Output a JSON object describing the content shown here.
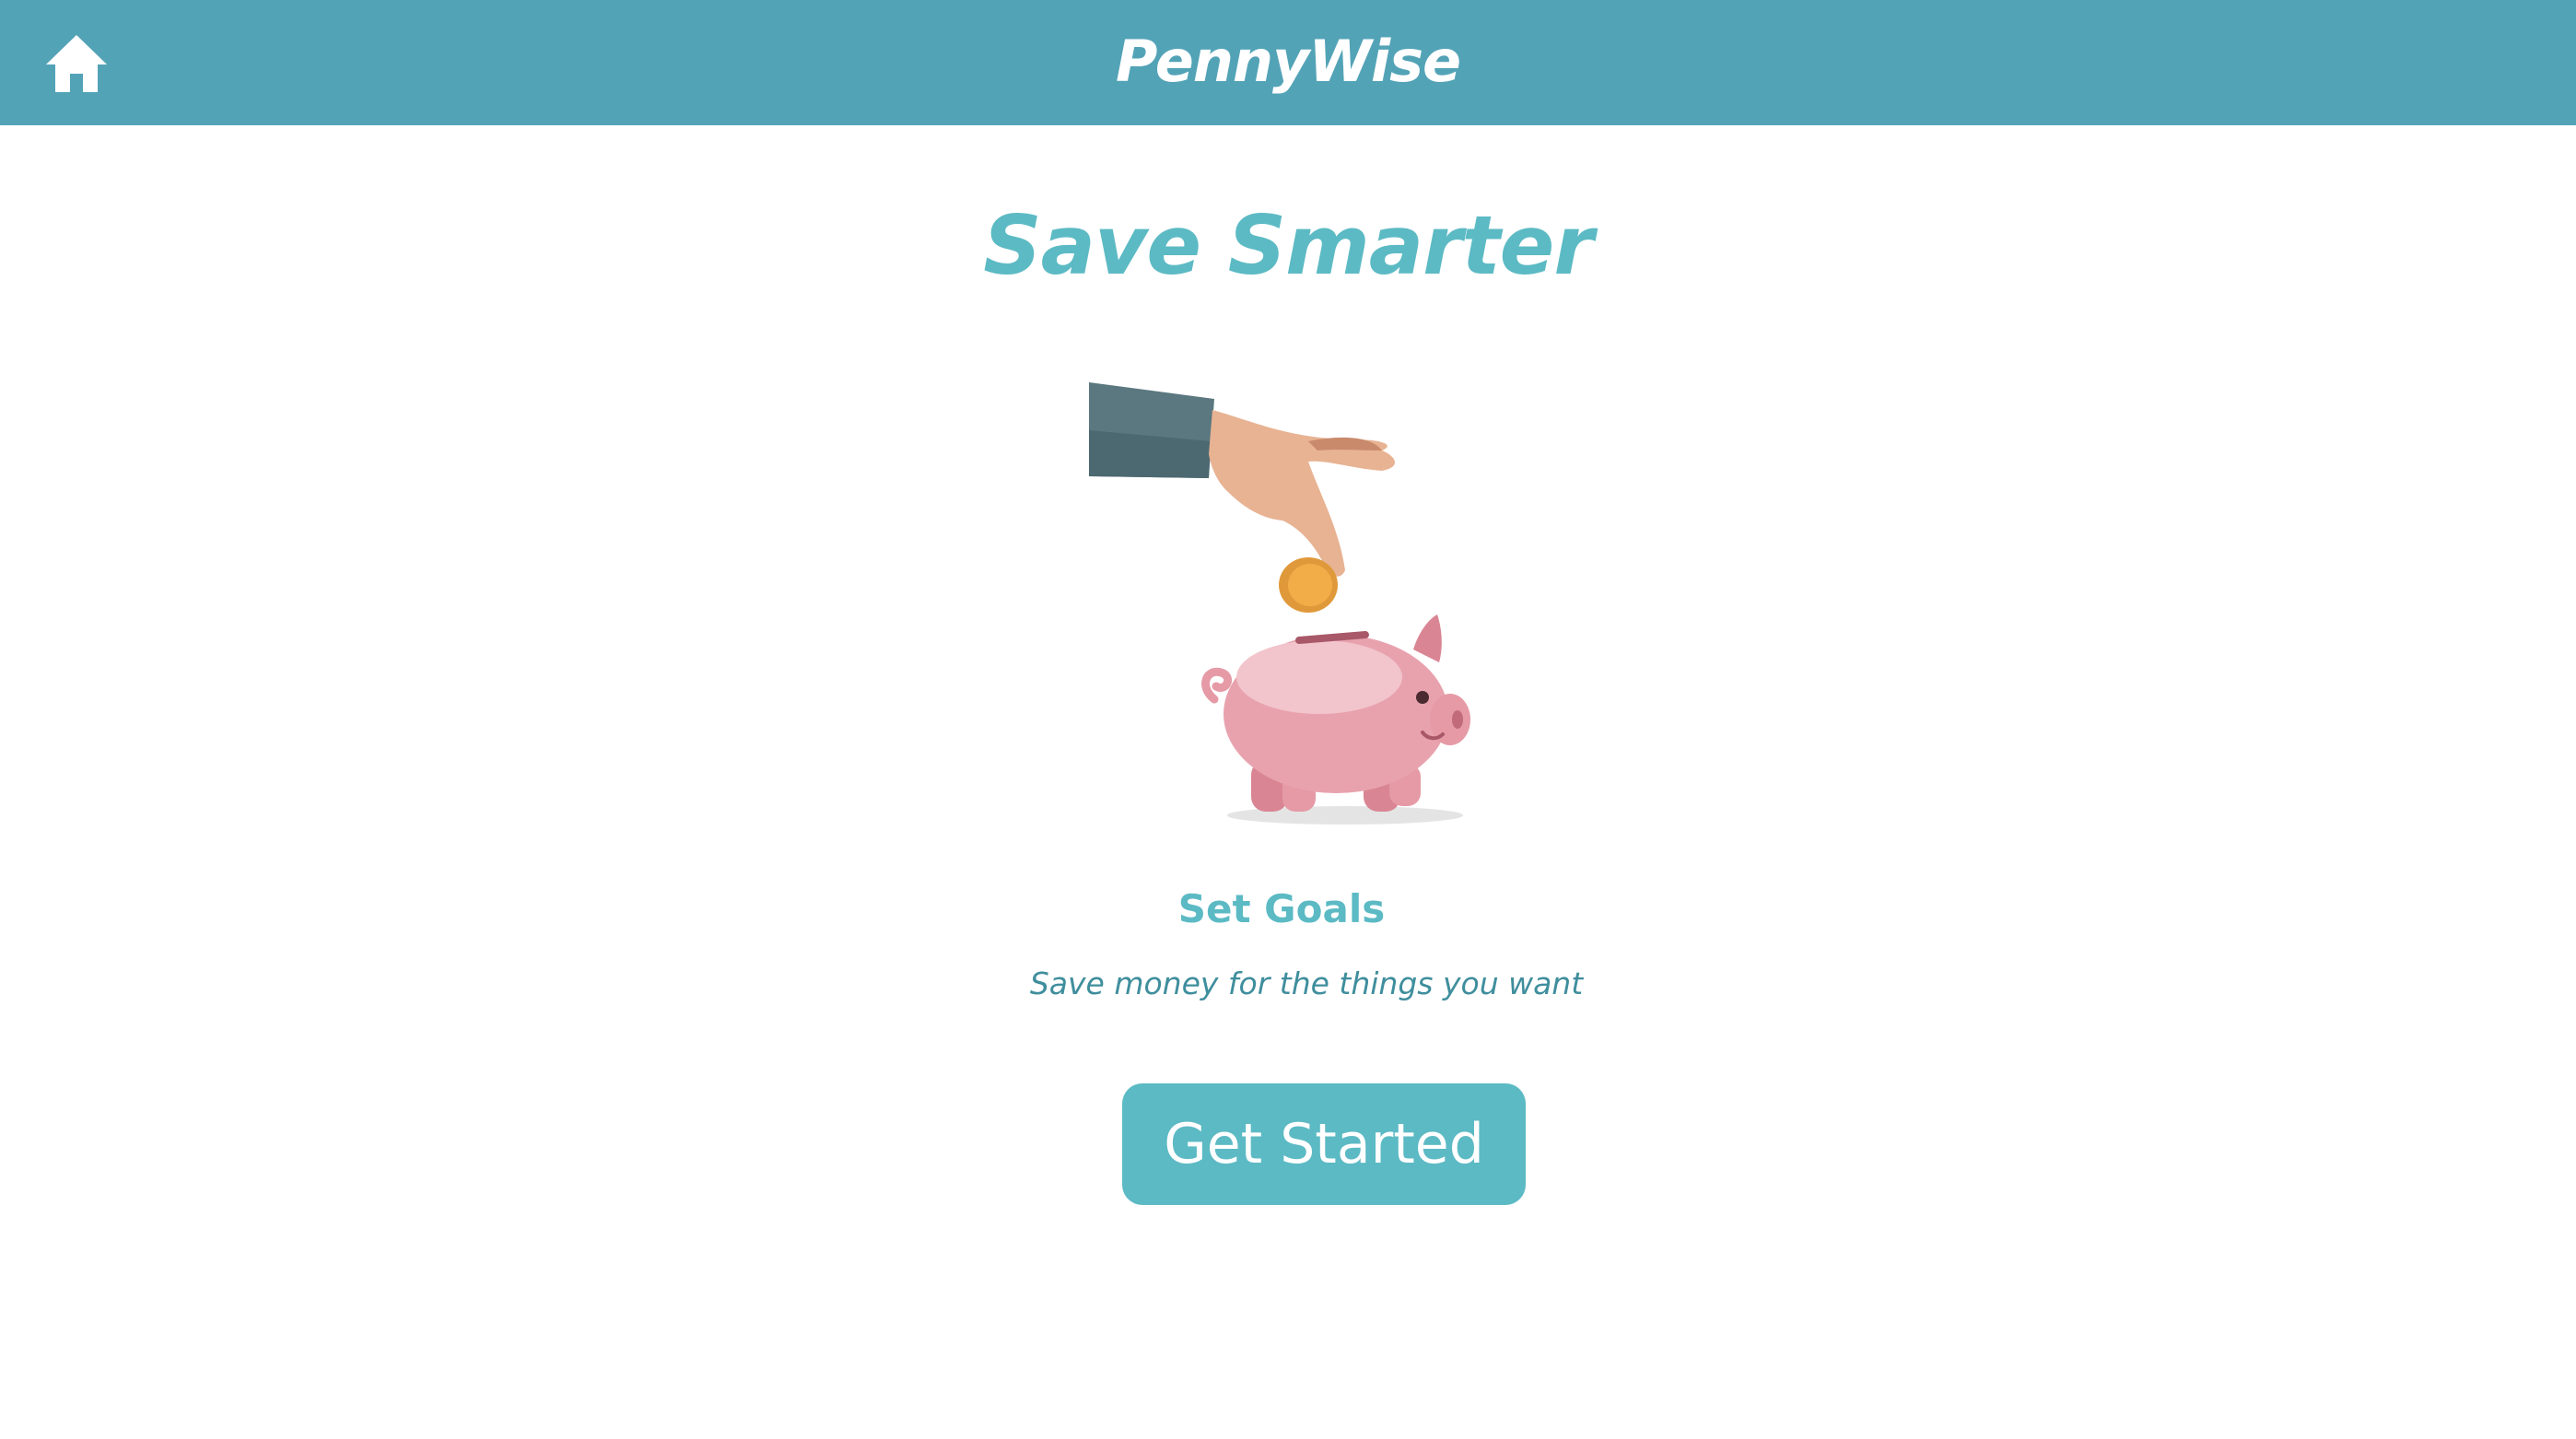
{
  "header": {
    "app_title": "PennyWise",
    "home_icon": "home-icon",
    "background_color": "#53a3b7"
  },
  "main": {
    "headline": "Save Smarter",
    "illustration": "hand-dropping-coin-into-piggy-bank",
    "feature_title": "Set Goals",
    "feature_description": "Save money for the things you want",
    "cta_label": "Get Started"
  },
  "colors": {
    "accent": "#5cbac4",
    "text_secondary": "#3f8e9d",
    "background": "#ffffff"
  }
}
